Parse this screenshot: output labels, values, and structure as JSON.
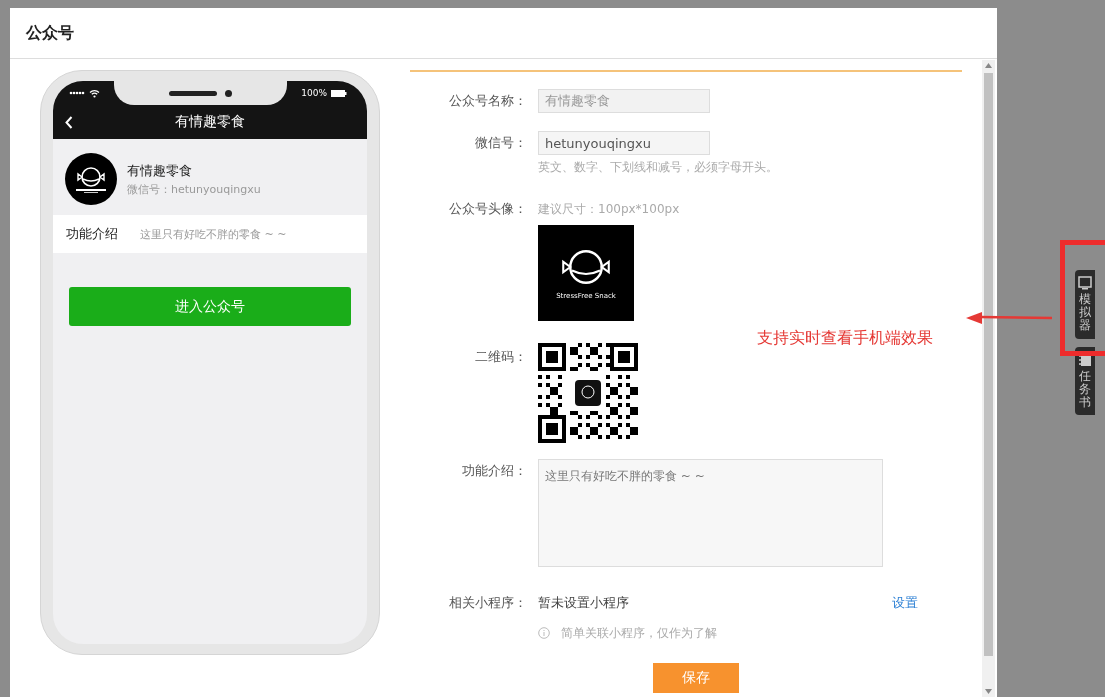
{
  "page": {
    "title": "公众号"
  },
  "phone": {
    "battery": "100%",
    "nav_title": "有情趣零食",
    "profile": {
      "name": "有情趣零食",
      "wechat_id": "微信号：hetunyouqingxu"
    },
    "intro": {
      "label": "功能介绍",
      "text": "这里只有好吃不胖的零食 ~ ~"
    },
    "enter_button": "进入公众号"
  },
  "form": {
    "name": {
      "label": "公众号名称：",
      "value": "有情趣零食",
      "disabled": true
    },
    "wechat_id": {
      "label": "微信号：",
      "value": "hetunyouqingxu",
      "hint": "英文、数字、下划线和减号，必须字母开头。"
    },
    "avatar": {
      "label": "公众号头像：",
      "hint": "建议尺寸：100px*100px",
      "logo_text": "StressFree Snack"
    },
    "qrcode": {
      "label": "二维码："
    },
    "intro": {
      "label": "功能介绍：",
      "value": "这里只有好吃不胖的零食 ~ ~"
    },
    "mini_program": {
      "label": "相关小程序：",
      "value": "暂未设置小程序",
      "link": "设置",
      "note": "简单关联小程序，仅作为了解"
    },
    "save_button": "保存"
  },
  "annotation": {
    "text": "支持实时查看手机端效果"
  },
  "side_tabs": [
    {
      "label": "模拟器",
      "kind": "simulator"
    },
    {
      "label": "任务书",
      "kind": "task"
    }
  ]
}
